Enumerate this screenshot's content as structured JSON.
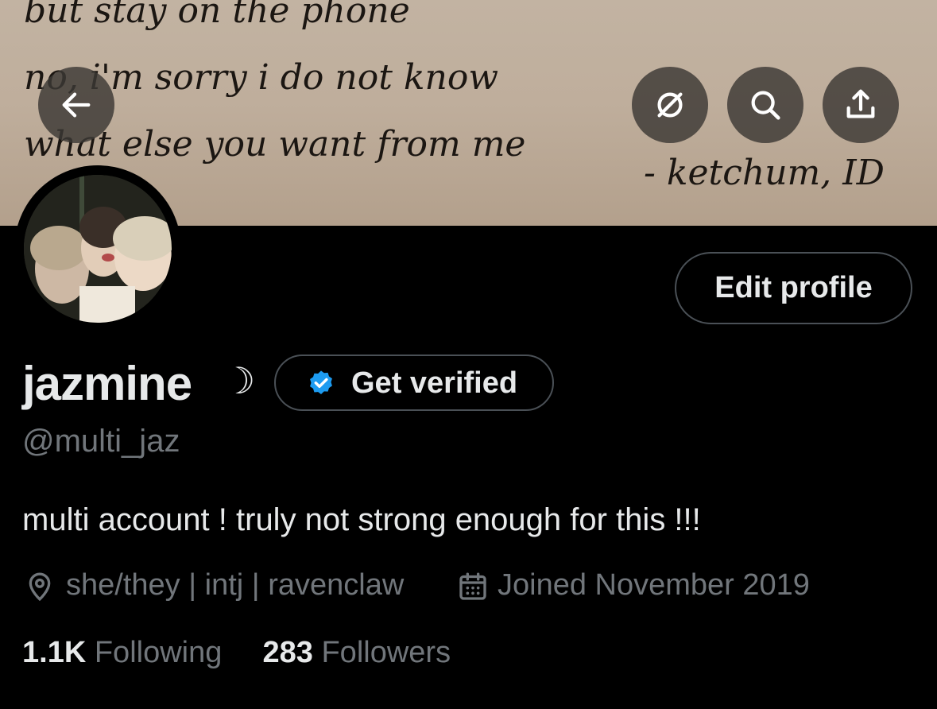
{
  "banner": {
    "handwriting": [
      "but stay on the phone",
      "no, i'm sorry i do not know",
      "what else you want from me",
      "- ketchum, ID"
    ]
  },
  "toolbar": {
    "back_icon": "arrow-left-icon",
    "grok_icon": "no-sign-icon",
    "search_icon": "search-icon",
    "share_icon": "share-icon"
  },
  "profile": {
    "edit_label": "Edit profile",
    "name": "jazmine",
    "name_emoji": "☽",
    "verify_label": "Get verified",
    "handle": "@multi_jaz",
    "bio": "multi account ! truly not strong enough for this !!!",
    "location": "she/they | intj | ravenclaw",
    "joined": "Joined November 2019",
    "following_count": "1.1K",
    "following_label": "Following",
    "followers_count": "283",
    "followers_label": "Followers"
  },
  "colors": {
    "background": "#000000",
    "text": "#e7e9ea",
    "secondary": "#71767b",
    "verified_blue": "#1d9bf0"
  }
}
